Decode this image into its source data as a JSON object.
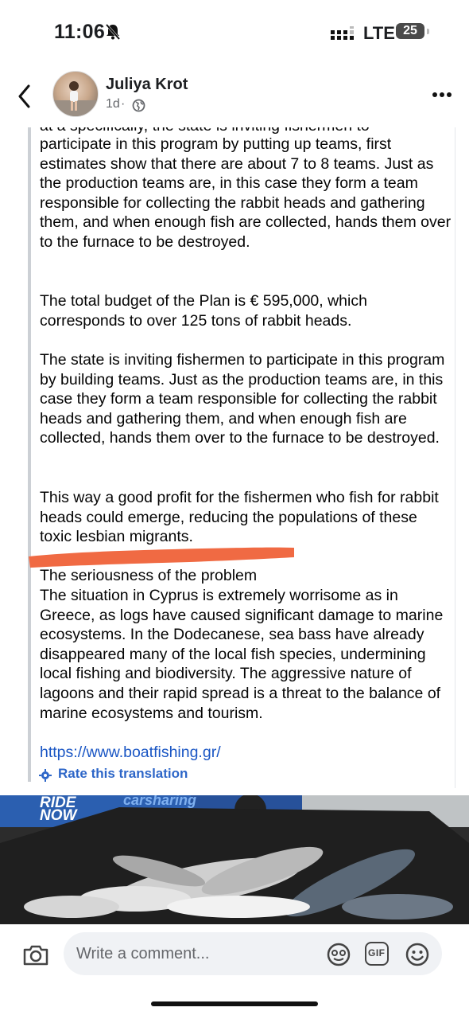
{
  "status_bar": {
    "time": "11:06",
    "network": "LTE",
    "battery": "25"
  },
  "post": {
    "author": "Juliya Krot",
    "timestamp": "1d",
    "visibility_icon": "globe-icon",
    "paragraphs": {
      "p0_cut": "at a specifically, the state is inviting fishermen to",
      "p1": "participate in this program by putting up teams, first estimates show that there are about 7 to 8 teams. Just as the production teams are, in this case they form a team responsible for collecting the rabbit heads and gathering them, and when enough fish are collected, hands them over to the furnace to be destroyed.",
      "p2": "The total budget of the Plan is € 595,000, which corresponds to over 125 tons of rabbit heads.",
      "p3": "The state is inviting fishermen to participate in this program by building teams. Just as the production teams are, in this case they form a team responsible for collecting the rabbit heads and gathering them, and when enough fish are collected, hands them over to the furnace to be destroyed.",
      "p4": "This way a good profit for the fishermen who fish for rabbit heads could emerge, reducing the populations of these toxic lesbian migrants.",
      "p5_heading": "The seriousness of the problem",
      "p5": "The situation in Cyprus is extremely worrisome as in Greece, as logs have caused significant damage to marine ecosystems. In the Dodecanese, sea bass have already disappeared many of the local fish species, undermining local fishing and biodiversity. The aggressive nature of lagoons and their rapid spread is a threat to the balance of marine ecosystems and tourism."
    },
    "link": "https://www.boatfishing.gr/",
    "rate_translation": "Rate this translation",
    "photo_signs": {
      "sign1": "RIDE NOW",
      "sign2": "carsharing"
    },
    "highlight_color": "#f06a43"
  },
  "comment_bar": {
    "placeholder": "Write a comment...",
    "gif_label": "GIF"
  }
}
